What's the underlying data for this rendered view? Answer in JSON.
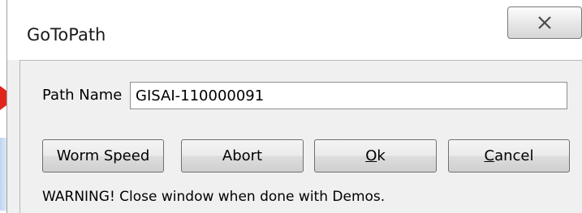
{
  "window": {
    "title": "GoToPath",
    "close_glyph": "✕"
  },
  "path_field": {
    "label": "Path Name",
    "value": "GISAI-110000091"
  },
  "buttons": {
    "worm_speed": "Worm Speed",
    "abort": "Abort",
    "ok": {
      "mnemonic": "O",
      "rest": "k"
    },
    "cancel": {
      "mnemonic": "C",
      "rest": "ancel"
    }
  },
  "warning": "WARNING! Close window when done with Demos.",
  "colors": {
    "dialog_bg": "#f0f0f0",
    "arrow": "#e0261c"
  }
}
